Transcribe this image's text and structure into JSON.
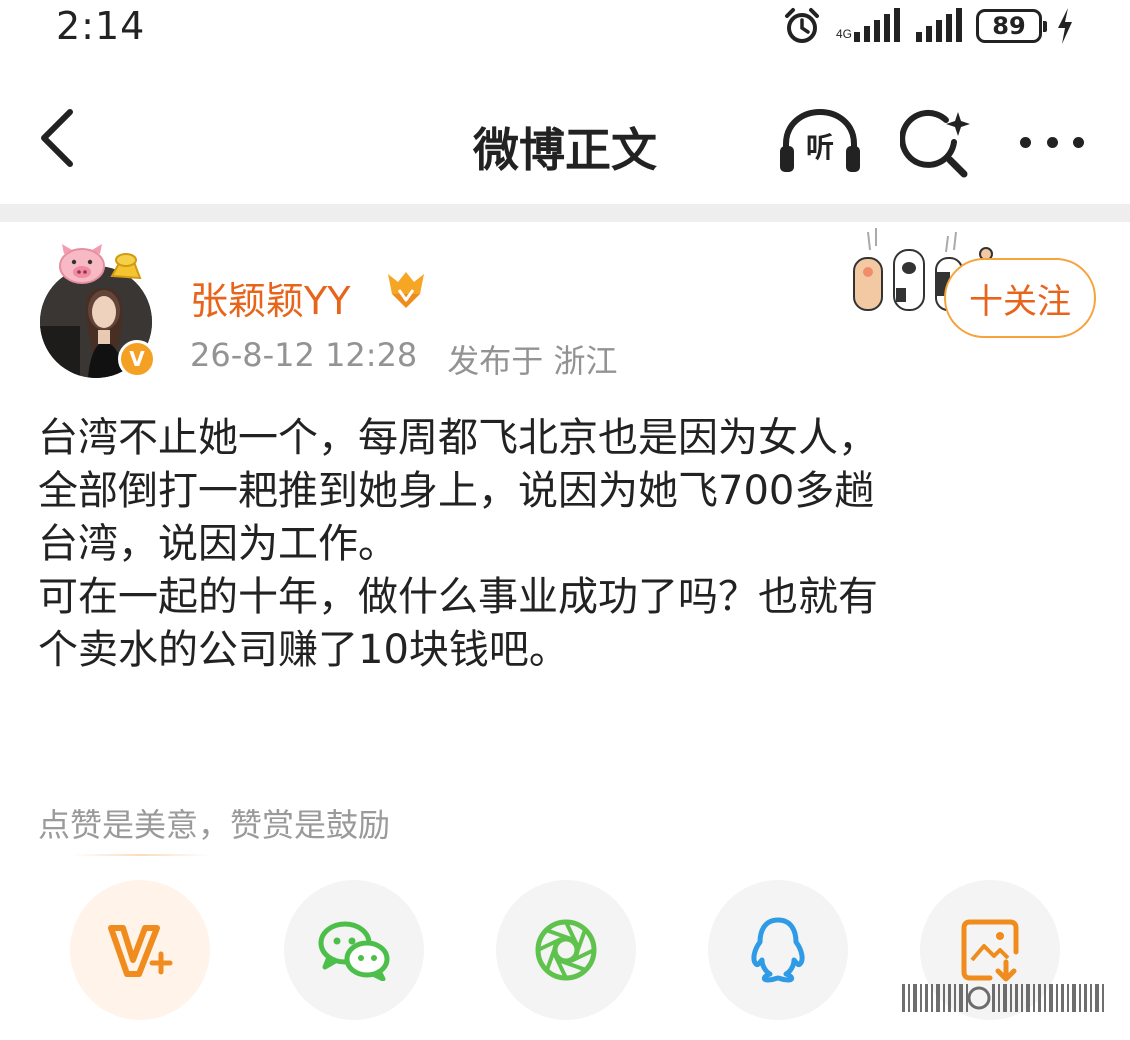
{
  "status_bar": {
    "time": "2:14",
    "battery": "89"
  },
  "nav": {
    "title": "微博正文",
    "listen_label": "听"
  },
  "author": {
    "name": "张颖颖YY",
    "verified_badge": "V",
    "post_time": "26-8-12 12:28",
    "published_from": "发布于 浙江",
    "follow_label": "十关注"
  },
  "post": {
    "lines": [
      "台湾不止她一个，每周都飞北京也是因为女人，",
      "全部倒打一耙推到她身上，说因为她飞700多趟",
      "台湾，说因为工作。",
      "可在一起的十年，做什么事业成功了吗？也就有",
      "个卖水的公司赚了10块钱吧。"
    ]
  },
  "reward_hint": "点赞是美意，赞赏是鼓励",
  "share_buttons": [
    {
      "icon": "v-plus-reward-icon",
      "color": "#f08c1e"
    },
    {
      "icon": "wechat-icon",
      "color": "#4cbf4a"
    },
    {
      "icon": "moments-shutter-icon",
      "color": "#5fc24d"
    },
    {
      "icon": "qq-penguin-icon",
      "color": "#2f9be6"
    },
    {
      "icon": "save-image-icon",
      "color": "#f08c1e"
    }
  ],
  "colors": {
    "accent_orange": "#e8641b",
    "follow_border": "#f7a23a",
    "meta_gray": "#939393"
  }
}
